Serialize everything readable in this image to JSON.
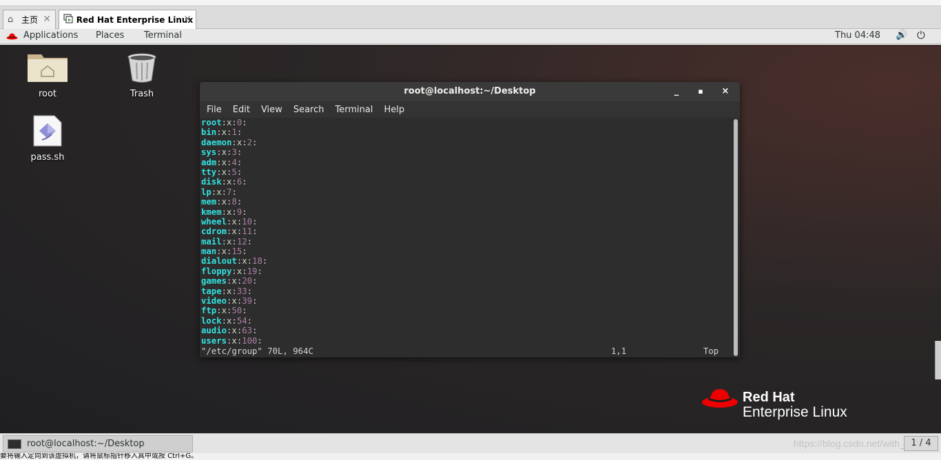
{
  "host_tabs": [
    {
      "label": "主页",
      "icon": "home-icon"
    },
    {
      "label": "Red Hat Enterprise Linux ...",
      "icon": "vm-icon"
    }
  ],
  "topbar": {
    "applications": "Applications",
    "places": "Places",
    "terminal": "Terminal",
    "clock": "Thu 04:48"
  },
  "desktop_icons": [
    {
      "label": "root",
      "icon": "home-folder-icon"
    },
    {
      "label": "Trash",
      "icon": "trash-icon"
    },
    {
      "label": "pass.sh",
      "icon": "script-file-icon"
    }
  ],
  "terminal": {
    "title": "root@localhost:~/Desktop",
    "menu": [
      "File",
      "Edit",
      "View",
      "Search",
      "Terminal",
      "Help"
    ],
    "lines": [
      {
        "group": "root",
        "gid": "0"
      },
      {
        "group": "bin",
        "gid": "1"
      },
      {
        "group": "daemon",
        "gid": "2"
      },
      {
        "group": "sys",
        "gid": "3"
      },
      {
        "group": "adm",
        "gid": "4"
      },
      {
        "group": "tty",
        "gid": "5"
      },
      {
        "group": "disk",
        "gid": "6"
      },
      {
        "group": "lp",
        "gid": "7"
      },
      {
        "group": "mem",
        "gid": "8"
      },
      {
        "group": "kmem",
        "gid": "9"
      },
      {
        "group": "wheel",
        "gid": "10"
      },
      {
        "group": "cdrom",
        "gid": "11"
      },
      {
        "group": "mail",
        "gid": "12"
      },
      {
        "group": "man",
        "gid": "15"
      },
      {
        "group": "dialout",
        "gid": "18"
      },
      {
        "group": "floppy",
        "gid": "19"
      },
      {
        "group": "games",
        "gid": "20"
      },
      {
        "group": "tape",
        "gid": "33"
      },
      {
        "group": "video",
        "gid": "39"
      },
      {
        "group": "ftp",
        "gid": "50"
      },
      {
        "group": "lock",
        "gid": "54"
      },
      {
        "group": "audio",
        "gid": "63"
      },
      {
        "group": "users",
        "gid": "100"
      }
    ],
    "status_file": "\"/etc/group\" 70L, 964C",
    "status_pos": "1,1",
    "status_scroll": "Top"
  },
  "logo": {
    "line1": "Red Hat",
    "line2": "Enterprise Linux"
  },
  "taskbar": {
    "window_label": "root@localhost:~/Desktop",
    "watermark": "https://blog.csdn.net/with_cat",
    "pager": "1 / 4"
  },
  "vm_status": "要将输入定向到该虚拟机，请将鼠标指针移入其中或按 Ctrl+G。"
}
